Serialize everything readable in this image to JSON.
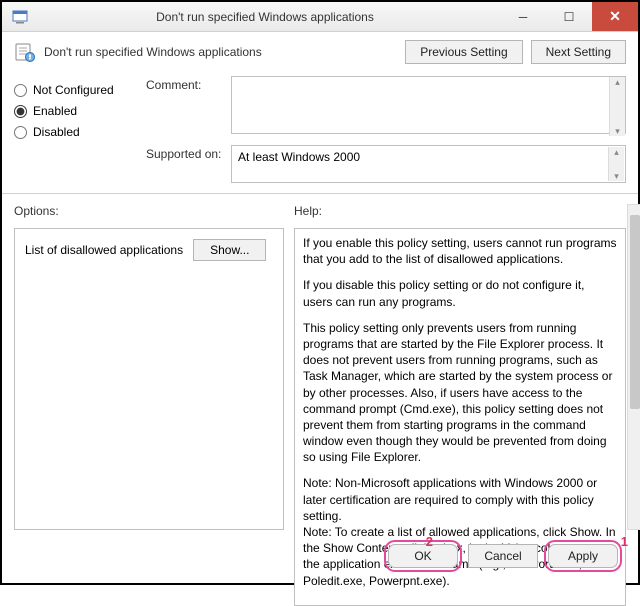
{
  "window": {
    "title": "Don't run specified Windows applications"
  },
  "header": {
    "policy_title": "Don't run specified Windows applications",
    "prev_btn": "Previous Setting",
    "next_btn": "Next Setting"
  },
  "radios": {
    "not_configured": "Not Configured",
    "enabled": "Enabled",
    "disabled": "Disabled",
    "selected": "enabled"
  },
  "form": {
    "comment_label": "Comment:",
    "comment_value": "",
    "supported_label": "Supported on:",
    "supported_value": "At least Windows 2000"
  },
  "lower": {
    "options_label": "Options:",
    "help_label": "Help:",
    "list_label": "List of disallowed applications",
    "show_btn": "Show...",
    "help_paragraphs": [
      "If you enable this policy setting, users cannot run programs that you add to the list of disallowed applications.",
      "If you disable this policy setting or do not configure it, users can run any programs.",
      "This policy setting only prevents users from running programs that are started by the File Explorer process. It does not prevent users from running programs, such as Task Manager, which are started by the system process or by other processes.  Also, if users have access to the command prompt (Cmd.exe), this policy setting does not prevent them from starting programs in the command window even though they would be prevented from doing so using File Explorer.",
      "Note: Non-Microsoft applications with Windows 2000 or later certification are required to comply with this policy setting.\nNote: To create a list of allowed applications, click Show.  In the Show Contents dialog box, in the Value column, type the application executable name (e.g., Winword.exe, Poledit.exe, Powerpnt.exe)."
    ]
  },
  "footer": {
    "ok": "OK",
    "cancel": "Cancel",
    "apply": "Apply"
  },
  "callouts": {
    "num1": "1",
    "num2": "2"
  }
}
